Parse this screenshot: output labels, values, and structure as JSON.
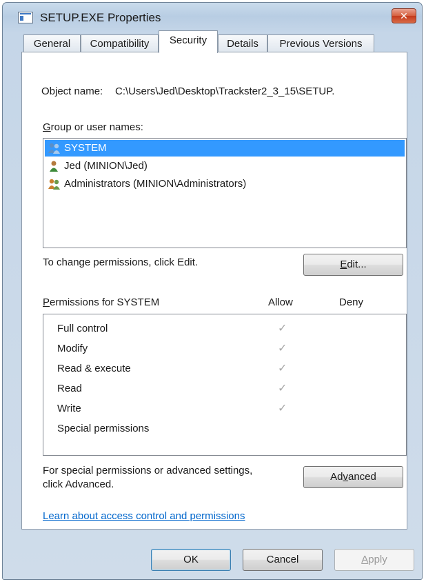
{
  "window": {
    "title": "SETUP.EXE Properties",
    "close_glyph": "✕"
  },
  "tabs": [
    {
      "label": "General",
      "active": false
    },
    {
      "label": "Compatibility",
      "active": false
    },
    {
      "label": "Security",
      "active": true
    },
    {
      "label": "Details",
      "active": false
    },
    {
      "label": "Previous Versions",
      "active": false
    }
  ],
  "object": {
    "label": "Object name:",
    "value": "C:\\Users\\Jed\\Desktop\\Trackster2_3_15\\SETUP."
  },
  "groups": {
    "label_hotkey": "G",
    "label_rest": "roup or user names:",
    "items": [
      {
        "name": "SYSTEM",
        "icon": "group-users-icon",
        "selected": true
      },
      {
        "name": "Jed (MINION\\Jed)",
        "icon": "user-icon",
        "selected": false
      },
      {
        "name": "Administrators (MINION\\Administrators)",
        "icon": "group-users-icon",
        "selected": false
      }
    ]
  },
  "change_text": "To change permissions, click Edit.",
  "edit_button": {
    "hotkey": "E",
    "rest": "dit..."
  },
  "permissions": {
    "label_hotkey": "P",
    "label_rest": "ermissions for SYSTEM",
    "allow_header": "Allow",
    "deny_header": "Deny",
    "rows": [
      {
        "name": "Full control",
        "allow": true,
        "deny": false
      },
      {
        "name": "Modify",
        "allow": true,
        "deny": false
      },
      {
        "name": "Read & execute",
        "allow": true,
        "deny": false
      },
      {
        "name": "Read",
        "allow": true,
        "deny": false
      },
      {
        "name": "Write",
        "allow": true,
        "deny": false
      },
      {
        "name": "Special permissions",
        "allow": false,
        "deny": false
      }
    ],
    "check_glyph": "✓"
  },
  "special": {
    "line1": "For special permissions or advanced settings,",
    "line2": "click Advanced."
  },
  "advanced_button": {
    "pre": "Ad",
    "hotkey": "v",
    "post": "anced"
  },
  "learn_link": "Learn about access control and permissions",
  "footer": {
    "ok": "OK",
    "cancel": "Cancel",
    "apply_hotkey": "A",
    "apply_rest": "pply"
  },
  "colors": {
    "selection": "#3399ff",
    "link": "#0066cc"
  }
}
